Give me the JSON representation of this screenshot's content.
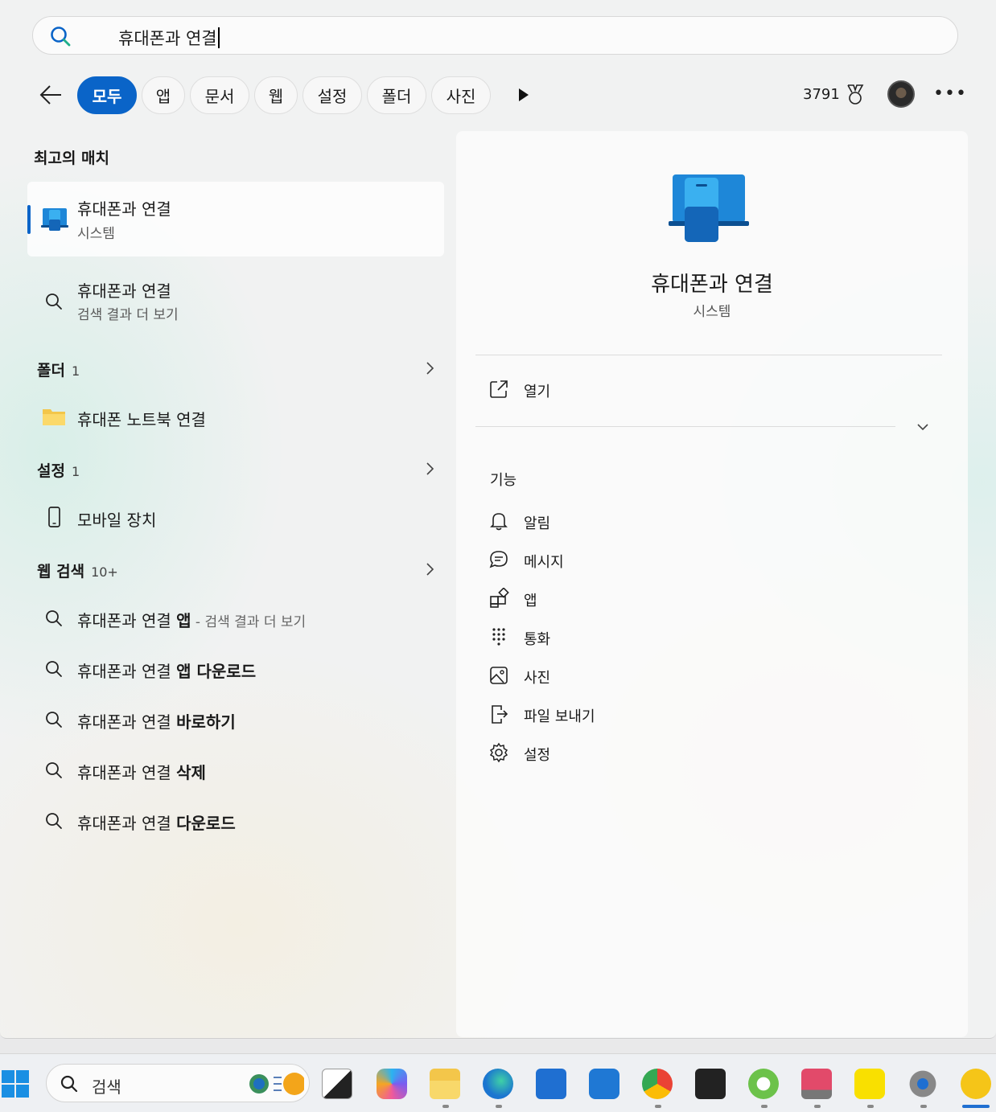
{
  "search": {
    "query": "휴대폰과 연결"
  },
  "filters": {
    "tabs": [
      "모두",
      "앱",
      "문서",
      "웹",
      "설정",
      "폴더",
      "사진"
    ],
    "active": "모두"
  },
  "header": {
    "points": "3791"
  },
  "left": {
    "best_match_title": "최고의 매치",
    "best_match": {
      "title": "휴대폰과 연결",
      "subtitle": "시스템"
    },
    "search_more": {
      "title": "휴대폰과 연결",
      "subtitle": "검색 결과 더 보기"
    },
    "folders": {
      "title": "폴더",
      "count": "1",
      "item": "휴대폰 노트북 연결"
    },
    "settings": {
      "title": "설정",
      "count": "1",
      "item": "모바일 장치"
    },
    "web": {
      "title": "웹 검색",
      "count": "10+",
      "items": [
        {
          "prefix": "휴대폰과 연결 ",
          "bold": "앱",
          "suffix": " - 검색 결과 더 보기"
        },
        {
          "prefix": "휴대폰과 연결 ",
          "bold": "앱 다운로드",
          "suffix": ""
        },
        {
          "prefix": "휴대폰과 연결 ",
          "bold": "바로하기",
          "suffix": ""
        },
        {
          "prefix": "휴대폰과 연결 ",
          "bold": "삭제",
          "suffix": ""
        },
        {
          "prefix": "휴대폰과 연결 ",
          "bold": "다운로드",
          "suffix": ""
        }
      ]
    }
  },
  "right": {
    "title": "휴대폰과 연결",
    "subtitle": "시스템",
    "open_label": "열기",
    "features_title": "기능",
    "features": [
      {
        "icon": "bell-icon",
        "label": "알림"
      },
      {
        "icon": "message-icon",
        "label": "메시지"
      },
      {
        "icon": "apps-icon",
        "label": "앱"
      },
      {
        "icon": "dialpad-icon",
        "label": "통화"
      },
      {
        "icon": "photo-icon",
        "label": "사진"
      },
      {
        "icon": "file-send-icon",
        "label": "파일 보내기"
      },
      {
        "icon": "gear-icon",
        "label": "설정"
      }
    ]
  },
  "taskbar": {
    "search_label": "검색",
    "apps": [
      "windows-start",
      "task-view",
      "copilot",
      "file-explorer",
      "edge",
      "microsoft-store",
      "outlook",
      "chrome",
      "recorder",
      "utorrent",
      "screen-tool",
      "kakaotalk",
      "settings",
      "media-player"
    ]
  },
  "colors": {
    "accent": "#0a64c8"
  }
}
